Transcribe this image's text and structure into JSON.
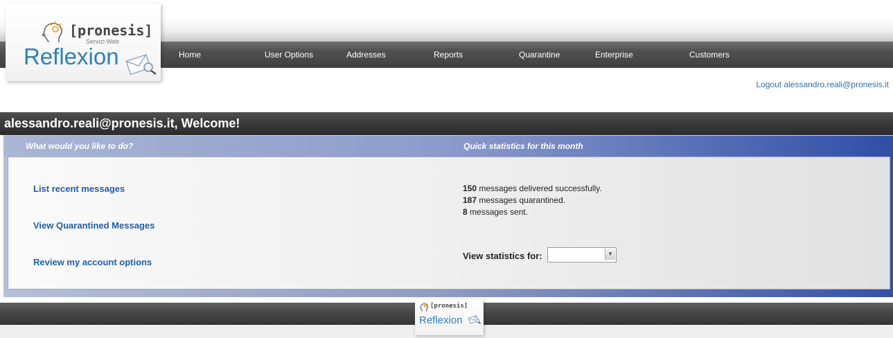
{
  "logo": {
    "brand": "[pronesis]",
    "subtitle": "Servizi Web",
    "product": "Reflexion",
    "icons": [
      "head-bulb-icon",
      "envelope-magnifier-icon"
    ]
  },
  "nav": {
    "items": [
      "Home",
      "User Options",
      "Addresses",
      "Reports",
      "Quarantine",
      "Enterprise",
      "Customers"
    ]
  },
  "header": {
    "logout_label": "Logout alessandro.reali@pronesis.it"
  },
  "welcome": {
    "title": "alessandro.reali@pronesis.it, Welcome!"
  },
  "panel": {
    "left_heading": "What would you like to do?",
    "right_heading": "Quick statistics for this month",
    "actions": [
      "List recent messages",
      "View Quarantined Messages",
      "Review my account options"
    ],
    "stats": [
      {
        "count": "150",
        "text": " messages delivered successfully."
      },
      {
        "count": "187",
        "text": " messages quarantined."
      },
      {
        "count": "8",
        "text": " messages sent."
      }
    ],
    "stats_for_label": "View statistics for:",
    "stats_for_value": ""
  },
  "footer": {
    "brand": "[pronesis]",
    "product": "Reflexion"
  },
  "colors": {
    "accent_blue": "#2d7fba",
    "link_blue": "#1f5fa8",
    "panel_blue": "#2f4ea6",
    "nav_dark": "#4a4a4a"
  }
}
